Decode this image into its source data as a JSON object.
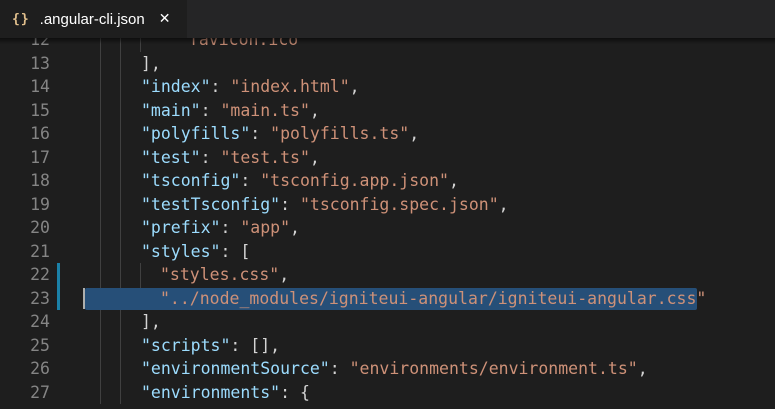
{
  "tab": {
    "icon": "{}",
    "icon_name": "json-file-icon",
    "label": ".angular-cli.json",
    "close": "✕"
  },
  "colors": {
    "key": "#9cdcfe",
    "string": "#ce9178",
    "punct": "#d4d4d4",
    "line_number": "#858585",
    "selection": "#264f78",
    "modified_gutter": "#1b81a8",
    "background": "#1e1e1e"
  },
  "lines": [
    {
      "n": "12",
      "indent": 2,
      "tokens": [
        {
          "t": "s",
          "v": "\"favicon.ico\""
        }
      ],
      "partial": true
    },
    {
      "n": "13",
      "indent": 0,
      "tokens": [
        {
          "t": "p",
          "v": "],"
        }
      ]
    },
    {
      "n": "14",
      "indent": 0,
      "tokens": [
        {
          "t": "k",
          "v": "\"index\""
        },
        {
          "t": "p",
          "v": ": "
        },
        {
          "t": "s",
          "v": "\"index.html\""
        },
        {
          "t": "p",
          "v": ","
        }
      ]
    },
    {
      "n": "15",
      "indent": 0,
      "tokens": [
        {
          "t": "k",
          "v": "\"main\""
        },
        {
          "t": "p",
          "v": ": "
        },
        {
          "t": "s",
          "v": "\"main.ts\""
        },
        {
          "t": "p",
          "v": ","
        }
      ]
    },
    {
      "n": "16",
      "indent": 0,
      "tokens": [
        {
          "t": "k",
          "v": "\"polyfills\""
        },
        {
          "t": "p",
          "v": ": "
        },
        {
          "t": "s",
          "v": "\"polyfills.ts\""
        },
        {
          "t": "p",
          "v": ","
        }
      ]
    },
    {
      "n": "17",
      "indent": 0,
      "tokens": [
        {
          "t": "k",
          "v": "\"test\""
        },
        {
          "t": "p",
          "v": ": "
        },
        {
          "t": "s",
          "v": "\"test.ts\""
        },
        {
          "t": "p",
          "v": ","
        }
      ]
    },
    {
      "n": "18",
      "indent": 0,
      "tokens": [
        {
          "t": "k",
          "v": "\"tsconfig\""
        },
        {
          "t": "p",
          "v": ": "
        },
        {
          "t": "s",
          "v": "\"tsconfig.app.json\""
        },
        {
          "t": "p",
          "v": ","
        }
      ]
    },
    {
      "n": "19",
      "indent": 0,
      "tokens": [
        {
          "t": "k",
          "v": "\"testTsconfig\""
        },
        {
          "t": "p",
          "v": ": "
        },
        {
          "t": "s",
          "v": "\"tsconfig.spec.json\""
        },
        {
          "t": "p",
          "v": ","
        }
      ]
    },
    {
      "n": "20",
      "indent": 0,
      "tokens": [
        {
          "t": "k",
          "v": "\"prefix\""
        },
        {
          "t": "p",
          "v": ": "
        },
        {
          "t": "s",
          "v": "\"app\""
        },
        {
          "t": "p",
          "v": ","
        }
      ]
    },
    {
      "n": "21",
      "indent": 0,
      "tokens": [
        {
          "t": "k",
          "v": "\"styles\""
        },
        {
          "t": "p",
          "v": ": ["
        }
      ]
    },
    {
      "n": "22",
      "indent": 1,
      "modified": true,
      "tokens": [
        {
          "t": "s",
          "v": "\"styles.css\""
        },
        {
          "t": "p",
          "v": ","
        }
      ]
    },
    {
      "n": "23",
      "indent": 1,
      "modified": true,
      "selected": true,
      "cursor": true,
      "tokens": [
        {
          "t": "s",
          "v": "\"../node_modules/igniteui-angular/igniteui-angular.css\""
        }
      ]
    },
    {
      "n": "24",
      "indent": 0,
      "tokens": [
        {
          "t": "p",
          "v": "],"
        }
      ]
    },
    {
      "n": "25",
      "indent": 0,
      "tokens": [
        {
          "t": "k",
          "v": "\"scripts\""
        },
        {
          "t": "p",
          "v": ": [],"
        }
      ]
    },
    {
      "n": "26",
      "indent": 0,
      "tokens": [
        {
          "t": "k",
          "v": "\"environmentSource\""
        },
        {
          "t": "p",
          "v": ": "
        },
        {
          "t": "s",
          "v": "\"environments/environment.ts\""
        },
        {
          "t": "p",
          "v": ","
        }
      ]
    },
    {
      "n": "27",
      "indent": 0,
      "tokens": [
        {
          "t": "k",
          "v": "\"environments\""
        },
        {
          "t": "p",
          "v": ": {"
        }
      ]
    }
  ]
}
